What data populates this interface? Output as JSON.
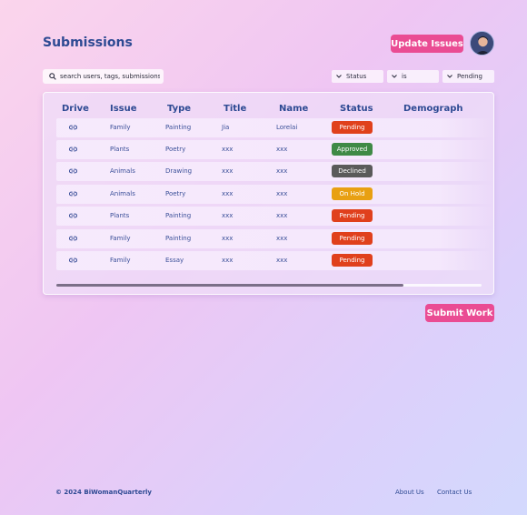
{
  "header": {
    "title": "Submissions",
    "update_label": "Update Issues"
  },
  "search": {
    "placeholder": "search users, tags, submissions"
  },
  "filters": {
    "field": "Status",
    "operator": "is",
    "value": "Pending"
  },
  "table": {
    "columns": [
      "Drive",
      "Issue",
      "Type",
      "Title",
      "Name",
      "Status",
      "Demograph"
    ],
    "rows": [
      {
        "issue": "Family",
        "type": "Painting",
        "title": "Jia",
        "name": "Lorelai",
        "status": "Pending",
        "status_color": "#e0401c"
      },
      {
        "issue": "Plants",
        "type": "Poetry",
        "title": "xxx",
        "name": "xxx",
        "status": "Approved",
        "status_color": "#3f8a46"
      },
      {
        "issue": "Animals",
        "type": "Drawing",
        "title": "xxx",
        "name": "xxx",
        "status": "Declined",
        "status_color": "#5a5a5a"
      },
      {
        "issue": "Animals",
        "type": "Poetry",
        "title": "xxx",
        "name": "xxx",
        "status": "On Hold",
        "status_color": "#e8a012"
      },
      {
        "issue": "Plants",
        "type": "Painting",
        "title": "xxx",
        "name": "xxx",
        "status": "Pending",
        "status_color": "#e0401c"
      },
      {
        "issue": "Family",
        "type": "Painting",
        "title": "xxx",
        "name": "xxx",
        "status": "Pending",
        "status_color": "#e0401c"
      },
      {
        "issue": "Family",
        "type": "Essay",
        "title": "xxx",
        "name": "xxx",
        "status": "Pending",
        "status_color": "#e0401c"
      }
    ]
  },
  "actions": {
    "submit_label": "Submit Work"
  },
  "footer": {
    "copyright": "© 2024 BiWomanQuarterly",
    "about": "About Us",
    "contact": "Contact Us"
  },
  "icons": {
    "search": "search-icon",
    "chevron": "chevron-down-icon",
    "drive": "link-icon"
  },
  "colors": {
    "accent": "#ea4c93",
    "heading": "#2e4a93"
  }
}
